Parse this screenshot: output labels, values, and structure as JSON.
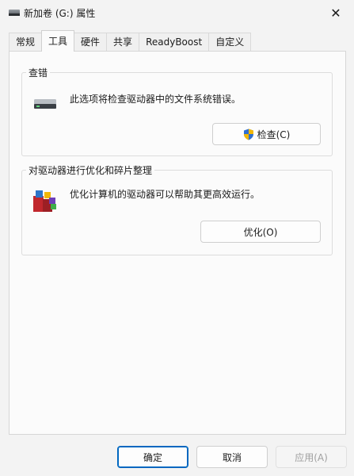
{
  "window": {
    "title": "新加卷 (G:) 属性",
    "close_glyph": "✕"
  },
  "tabs": [
    {
      "label": "常规"
    },
    {
      "label": "工具"
    },
    {
      "label": "硬件"
    },
    {
      "label": "共享"
    },
    {
      "label": "ReadyBoost"
    },
    {
      "label": "自定义"
    }
  ],
  "active_tab": "工具",
  "error_check": {
    "title": "查错",
    "description": "此选项将检查驱动器中的文件系统错误。",
    "button_label": "检查(C)"
  },
  "optimize": {
    "title": "对驱动器进行优化和碎片整理",
    "description": "优化计算机的驱动器可以帮助其更高效运行。",
    "button_label": "优化(O)"
  },
  "footer": {
    "ok_label": "确定",
    "cancel_label": "取消",
    "apply_label": "应用(A)"
  },
  "icons": {
    "title": "drive-icon",
    "check_group": "drive-icon",
    "check_button": "shield-icon",
    "optimize_group": "defrag-icon",
    "close": "close-icon"
  },
  "colors": {
    "accent": "#0067c0",
    "window_bg": "#f3f3f3",
    "panel_bg": "#fbfbfb"
  }
}
